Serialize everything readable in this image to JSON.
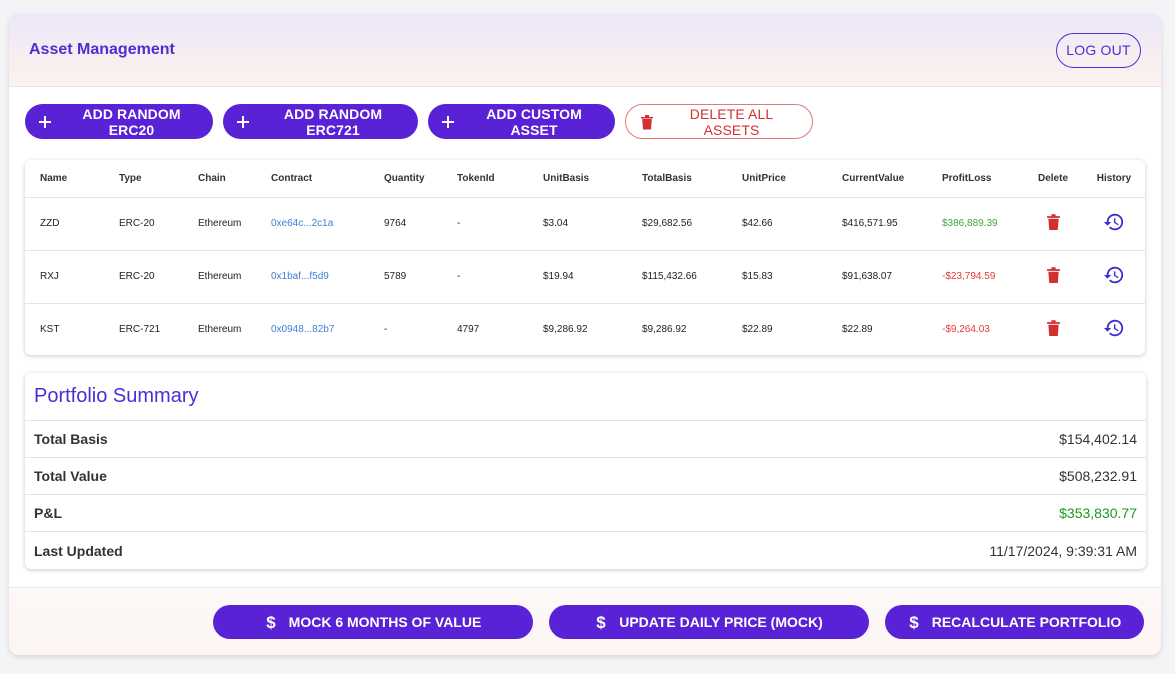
{
  "header": {
    "title": "Asset Management",
    "logout_label": "LOG OUT"
  },
  "actions": [
    {
      "label": "ADD RANDOM ERC20",
      "icon": "plus-icon"
    },
    {
      "label": "ADD RANDOM ERC721",
      "icon": "plus-icon"
    },
    {
      "label": "ADD CUSTOM ASSET",
      "icon": "plus-icon"
    },
    {
      "label": "DELETE ALL ASSETS",
      "icon": "trash-icon"
    }
  ],
  "table": {
    "headers": [
      "Name",
      "Type",
      "Chain",
      "Contract",
      "Quantity",
      "TokenId",
      "UnitBasis",
      "TotalBasis",
      "UnitPrice",
      "CurrentValue",
      "ProfitLoss",
      "Delete",
      "History"
    ],
    "rows": [
      {
        "name": "ZZD",
        "type": "ERC-20",
        "chain": "Ethereum",
        "contract": "0xe64c...2c1a",
        "quantity": "9764",
        "tokenId": "-",
        "unitBasis": "$3.04",
        "totalBasis": "$29,682.56",
        "unitPrice": "$42.66",
        "currentValue": "$416,571.95",
        "profitLoss": "$386,889.39"
      },
      {
        "name": "RXJ",
        "type": "ERC-20",
        "chain": "Ethereum",
        "contract": "0x1baf...f5d9",
        "quantity": "5789",
        "tokenId": "-",
        "unitBasis": "$19.94",
        "totalBasis": "$115,432.66",
        "unitPrice": "$15.83",
        "currentValue": "$91,638.07",
        "profitLoss": "-$23,794.59"
      },
      {
        "name": "KST",
        "type": "ERC-721",
        "chain": "Ethereum",
        "contract": "0x0948...82b7",
        "quantity": "-",
        "tokenId": "4797",
        "unitBasis": "$9,286.92",
        "totalBasis": "$9,286.92",
        "unitPrice": "$22.89",
        "currentValue": "$22.89",
        "profitLoss": "-$9,264.03"
      }
    ]
  },
  "summary": {
    "title": "Portfolio Summary",
    "rows": [
      {
        "label": "Total Basis",
        "value": "$154,402.14"
      },
      {
        "label": "Total Value",
        "value": "$508,232.91"
      },
      {
        "label": "P&L",
        "value": "$353,830.77"
      },
      {
        "label": "Last Updated",
        "value": "11/17/2024, 9:39:31 AM"
      }
    ]
  },
  "footer": [
    {
      "label": "MOCK 6 MONTHS OF VALUE",
      "icon": "dollar-icon"
    },
    {
      "label": "UPDATE DAILY PRICE (MOCK)",
      "icon": "dollar-icon"
    },
    {
      "label": "RECALCULATE PORTFOLIO",
      "icon": "dollar-icon"
    }
  ],
  "colors": {
    "accent": "#5a22d6",
    "title": "#4b2fd1",
    "danger": "#d32f2f",
    "profit": "#3ba93b",
    "loss": "#e53935",
    "link": "#3f7fd6"
  }
}
